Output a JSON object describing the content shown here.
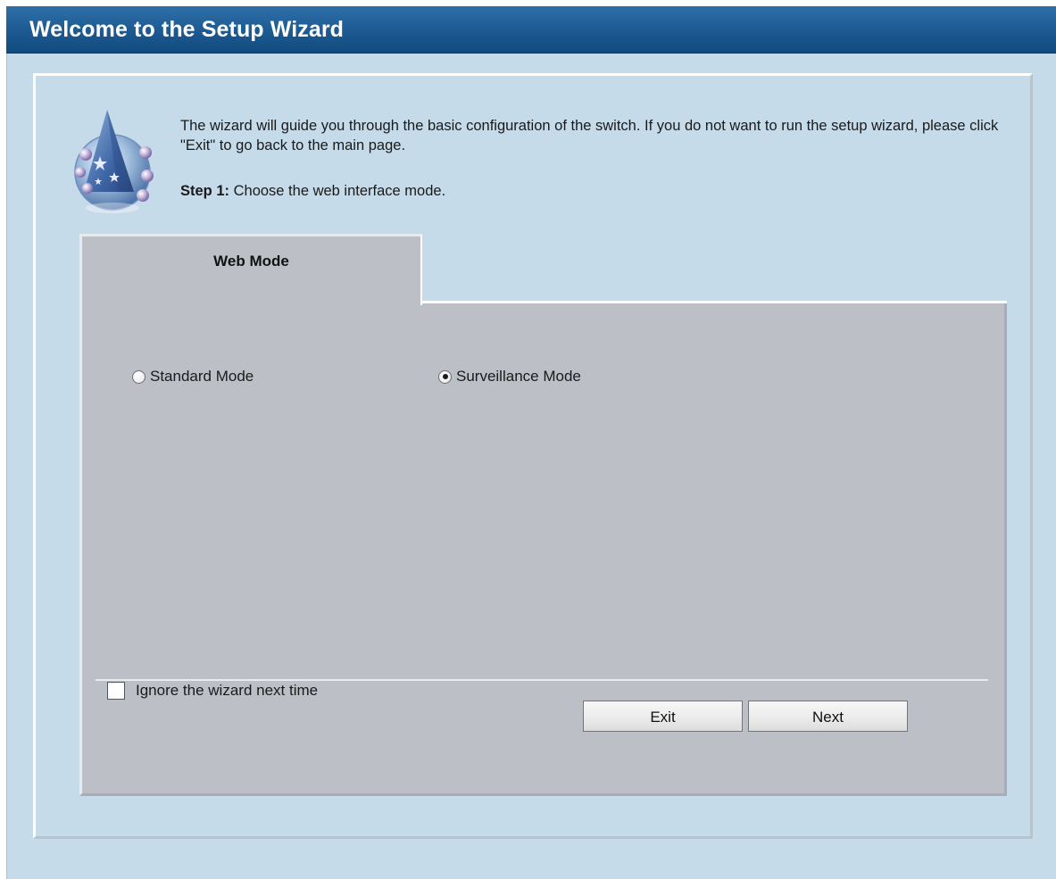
{
  "window": {
    "title": "Welcome to the Setup Wizard"
  },
  "intro": {
    "text": "The wizard will guide you through the basic configuration of the switch. If you do not want to run the setup wizard, please click \"Exit\" to go back to the main page.",
    "step_label": "Step 1:",
    "step_text": " Choose the web interface mode."
  },
  "tab": {
    "label": "Web Mode"
  },
  "modes": {
    "standard": {
      "label": "Standard Mode",
      "selected": false
    },
    "surveillance": {
      "label": "Surveillance Mode",
      "selected": true
    }
  },
  "footer": {
    "ignore_label": "Ignore the wizard next time",
    "ignore_checked": false,
    "exit_label": "Exit",
    "next_label": "Next"
  },
  "colors": {
    "titlebar": "#1f5d95",
    "background": "#c6dbea",
    "panel": "#bcc0c6"
  },
  "icons": {
    "logo": "wizard-hat-icon"
  }
}
